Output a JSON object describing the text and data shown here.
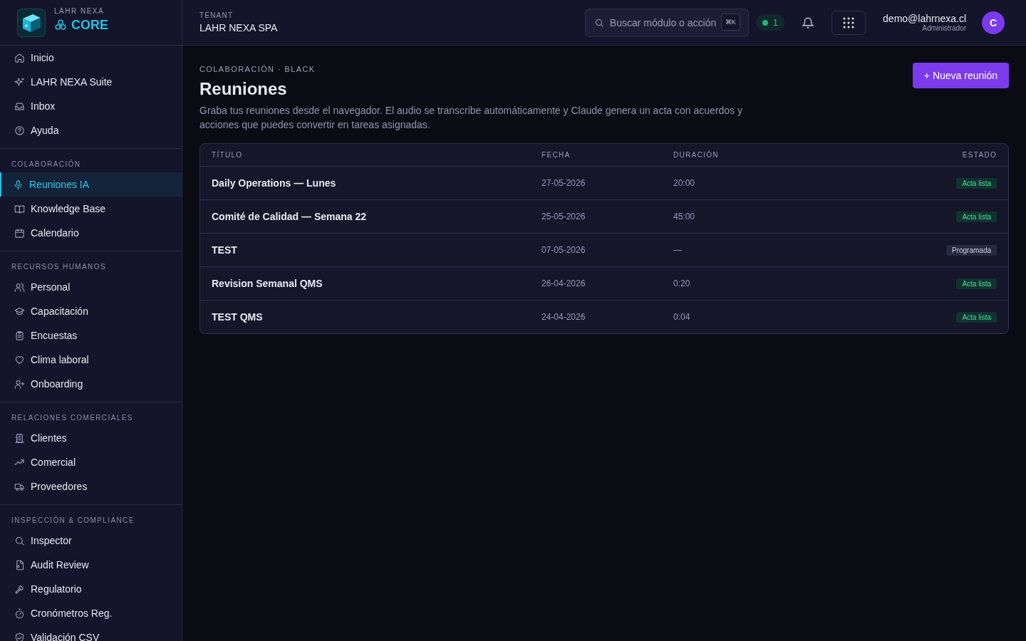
{
  "brand": {
    "overline": "LAHR NEXA",
    "name": "CORE"
  },
  "topbar": {
    "tenant_label": "TENANT",
    "tenant": "LAHR NEXA SPA",
    "search": {
      "placeholder": "Buscar módulo o acción",
      "shortcut": "⌘K"
    },
    "online_count": "1",
    "user": {
      "email": "demo@lahrnexa.cl",
      "role": "Administrador",
      "avatar": "C"
    }
  },
  "sidebar": {
    "sections": [
      {
        "items": [
          {
            "label": "Inicio",
            "selected": false
          },
          {
            "label": "LAHR NEXA Suite",
            "selected": false
          },
          {
            "label": "Inbox",
            "selected": false
          },
          {
            "label": "Ayuda",
            "selected": false
          }
        ]
      },
      {
        "title": "COLABORACIÓN",
        "items": [
          {
            "label": "Reuniones IA",
            "selected": true
          },
          {
            "label": "Knowledge Base",
            "selected": false
          },
          {
            "label": "Calendario",
            "selected": false
          }
        ]
      },
      {
        "title": "RECURSOS HUMANOS",
        "items": [
          {
            "label": "Personal",
            "selected": false
          },
          {
            "label": "Capacitación",
            "selected": false
          },
          {
            "label": "Encuestas",
            "selected": false
          },
          {
            "label": "Clima laboral",
            "selected": false
          },
          {
            "label": "Onboarding",
            "selected": false
          }
        ]
      },
      {
        "title": "RELACIONES COMERCIALES",
        "items": [
          {
            "label": "Clientes",
            "selected": false
          },
          {
            "label": "Comercial",
            "selected": false
          },
          {
            "label": "Proveedores",
            "selected": false
          }
        ]
      },
      {
        "title": "INSPECCIÓN & COMPLIANCE",
        "items": [
          {
            "label": "Inspector",
            "selected": false
          },
          {
            "label": "Audit Review",
            "selected": false
          },
          {
            "label": "Regulatorio",
            "selected": false
          },
          {
            "label": "Cronómetros Reg.",
            "selected": false
          },
          {
            "label": "Validación CSV",
            "selected": false
          }
        ]
      }
    ]
  },
  "page": {
    "breadcrumb": "COLABORACIÓN · BLACK",
    "title": "Reuniones",
    "description": "Graba tus reuniones desde el navegador. El audio se transcribe automáticamente y Claude genera un acta con acuerdos y acciones que puedes convertir en tareas asignadas.",
    "new_button": "+ Nueva reunión"
  },
  "table": {
    "columns": [
      "TÍTULO",
      "FECHA",
      "DURACIÓN",
      "ESTADO"
    ],
    "rows": [
      {
        "title": "Daily Operations — Lunes",
        "date": "27-05-2026",
        "duration": "20:00",
        "status": "Acta lista",
        "kind": "ready"
      },
      {
        "title": "Comité de Calidad — Semana 22",
        "date": "25-05-2026",
        "duration": "45:00",
        "status": "Acta lista",
        "kind": "ready"
      },
      {
        "title": "TEST",
        "date": "07-05-2026",
        "duration": "—",
        "status": "Programada",
        "kind": "scheduled"
      },
      {
        "title": "Revision Semanal QMS",
        "date": "26-04-2026",
        "duration": "0:20",
        "status": "Acta lista",
        "kind": "ready"
      },
      {
        "title": "TEST QMS",
        "date": "24-04-2026",
        "duration": "0:04",
        "status": "Acta lista",
        "kind": "ready"
      }
    ]
  }
}
